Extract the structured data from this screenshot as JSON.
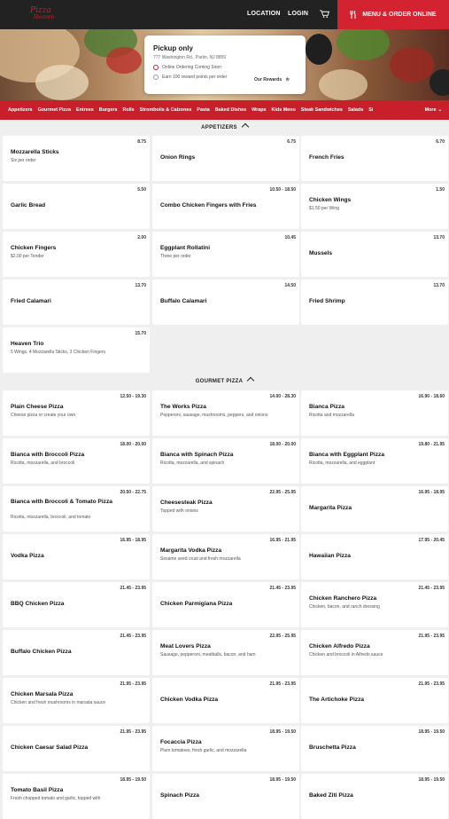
{
  "header": {
    "logo_line1": "Pizza",
    "logo_line2": "Heaven",
    "location": "LOCATION",
    "login": "LOGIN",
    "menu_order": "MENU & ORDER ONLINE"
  },
  "store_card": {
    "title": "Pickup only",
    "address": "777 Washington Rd., Parlin, NJ 8859",
    "online_ordering": "Online Ordering Coming Soon",
    "reward_text": "Earn 100 reward points per order",
    "rewards_link": "Our Rewards"
  },
  "categories": [
    "Appetizers",
    "Gourmet Pizza",
    "Entrees",
    "Burgers",
    "Rolls",
    "Strombolis & Calzones",
    "Pasta",
    "Baked Dishes",
    "Wraps",
    "Kids Menu",
    "Steak Sandwiches",
    "Salads",
    "Si"
  ],
  "more_label": "More",
  "sections": {
    "appetizers": "APPETIZERS",
    "gourmet": "GOURMET PIZZA"
  },
  "appetizers": [
    {
      "name": "Mozzarella Sticks",
      "price": "8.75",
      "desc": "Six per order"
    },
    {
      "name": "Onion Rings",
      "price": "6.75",
      "desc": ""
    },
    {
      "name": "French Fries",
      "price": "6.70",
      "desc": ""
    },
    {
      "name": "Garlic Bread",
      "price": "5.50",
      "desc": ""
    },
    {
      "name": "Combo Chicken Fingers with Fries",
      "price": "10.50 - 18.50",
      "desc": ""
    },
    {
      "name": "Chicken Wings",
      "price": "1.50",
      "desc": "$1.50 per Wing"
    },
    {
      "name": "Chicken Fingers",
      "price": "2.00",
      "desc": "$2.00 per Tender"
    },
    {
      "name": "Eggplant Rollatini",
      "price": "10.45",
      "desc": "Three per order"
    },
    {
      "name": "Mussels",
      "price": "13.70",
      "desc": ""
    },
    {
      "name": "Fried Calamari",
      "price": "13.70",
      "desc": ""
    },
    {
      "name": "Buffalo Calamari",
      "price": "14.50",
      "desc": ""
    },
    {
      "name": "Fried Shrimp",
      "price": "13.70",
      "desc": ""
    },
    {
      "name": "Heaven Trio",
      "price": "15.70",
      "desc": "5 Wings, 4 Mozzarella Sticks, 3 Chicken Fingers"
    }
  ],
  "gourmet": [
    {
      "name": "Plain Cheese Pizza",
      "price": "12.50 - 19.30",
      "desc": "Cheese pizza or create your own"
    },
    {
      "name": "The Works Pizza",
      "price": "14.00 - 28.30",
      "desc": "Pepperoni, sausage, mushrooms, peppers, and onions"
    },
    {
      "name": "Bianca Pizza",
      "price": "16.90 - 18.60",
      "desc": "Ricotta and mozzarella"
    },
    {
      "name": "Bianca with Broccoli Pizza",
      "price": "18.00 - 20.00",
      "desc": "Ricotta, mozzarella, and broccoli"
    },
    {
      "name": "Bianca with Spinach Pizza",
      "price": "18.00 - 20.00",
      "desc": "Ricotta, mozzarella, and spinach"
    },
    {
      "name": "Bianca with Eggplant Pizza",
      "price": "19.80 - 21.95",
      "desc": "Ricotta, mozzarella, and eggplant"
    },
    {
      "name": "Bianca with Broccoli & Tomato Pizza",
      "price": "20.50 - 22.75",
      "desc": "Ricotta, mozzarella, broccoli, and tomato"
    },
    {
      "name": "Cheesesteak Pizza",
      "price": "22.95 - 25.95",
      "desc": "Topped with onions"
    },
    {
      "name": "Margarita Pizza",
      "price": "16.95 - 18.95",
      "desc": ""
    },
    {
      "name": "Vodka Pizza",
      "price": "16.95 - 18.95",
      "desc": ""
    },
    {
      "name": "Margarita Vodka Pizza",
      "price": "16.95 - 21.95",
      "desc": "Sesame seed crust and fresh mozzarella"
    },
    {
      "name": "Hawaiian Pizza",
      "price": "17.95 - 20.45",
      "desc": ""
    },
    {
      "name": "BBQ Chicken Pizza",
      "price": "21.45 - 23.95",
      "desc": ""
    },
    {
      "name": "Chicken Parmigiana Pizza",
      "price": "21.45 - 23.95",
      "desc": ""
    },
    {
      "name": "Chicken Ranchero Pizza",
      "price": "21.45 - 23.95",
      "desc": "Chicken, bacon, and ranch dressing"
    },
    {
      "name": "Buffalo Chicken Pizza",
      "price": "21.45 - 23.95",
      "desc": ""
    },
    {
      "name": "Meat Lovers Pizza",
      "price": "22.95 - 25.95",
      "desc": "Sausage, pepperoni, meatballs, bacon, and ham"
    },
    {
      "name": "Chicken Alfredo Pizza",
      "price": "21.95 - 23.95",
      "desc": "Chicken and broccoli in Alfredo sauce"
    },
    {
      "name": "Chicken Marsala Pizza",
      "price": "21.95 - 23.95",
      "desc": "Chicken and fresh mushrooms in marsala sauce"
    },
    {
      "name": "Chicken Vodka Pizza",
      "price": "21.95 - 23.95",
      "desc": ""
    },
    {
      "name": "The Artichoke Pizza",
      "price": "21.95 - 23.95",
      "desc": ""
    },
    {
      "name": "Chicken Caesar Salad Pizza",
      "price": "21.95 - 23.95",
      "desc": ""
    },
    {
      "name": "Focaccia Pizza",
      "price": "18.95 - 19.50",
      "desc": "Plum tomatoes, fresh garlic, and mozzarella"
    },
    {
      "name": "Bruschetta Pizza",
      "price": "18.95 - 19.50",
      "desc": ""
    },
    {
      "name": "Tomato Basil Pizza",
      "price": "18.95 - 19.50",
      "desc": "Fresh chopped tomato and garlic, topped with"
    },
    {
      "name": "Spinach Pizza",
      "price": "18.95 - 19.50",
      "desc": ""
    },
    {
      "name": "Baked Ziti Pizza",
      "price": "18.95 - 19.50",
      "desc": ""
    }
  ]
}
